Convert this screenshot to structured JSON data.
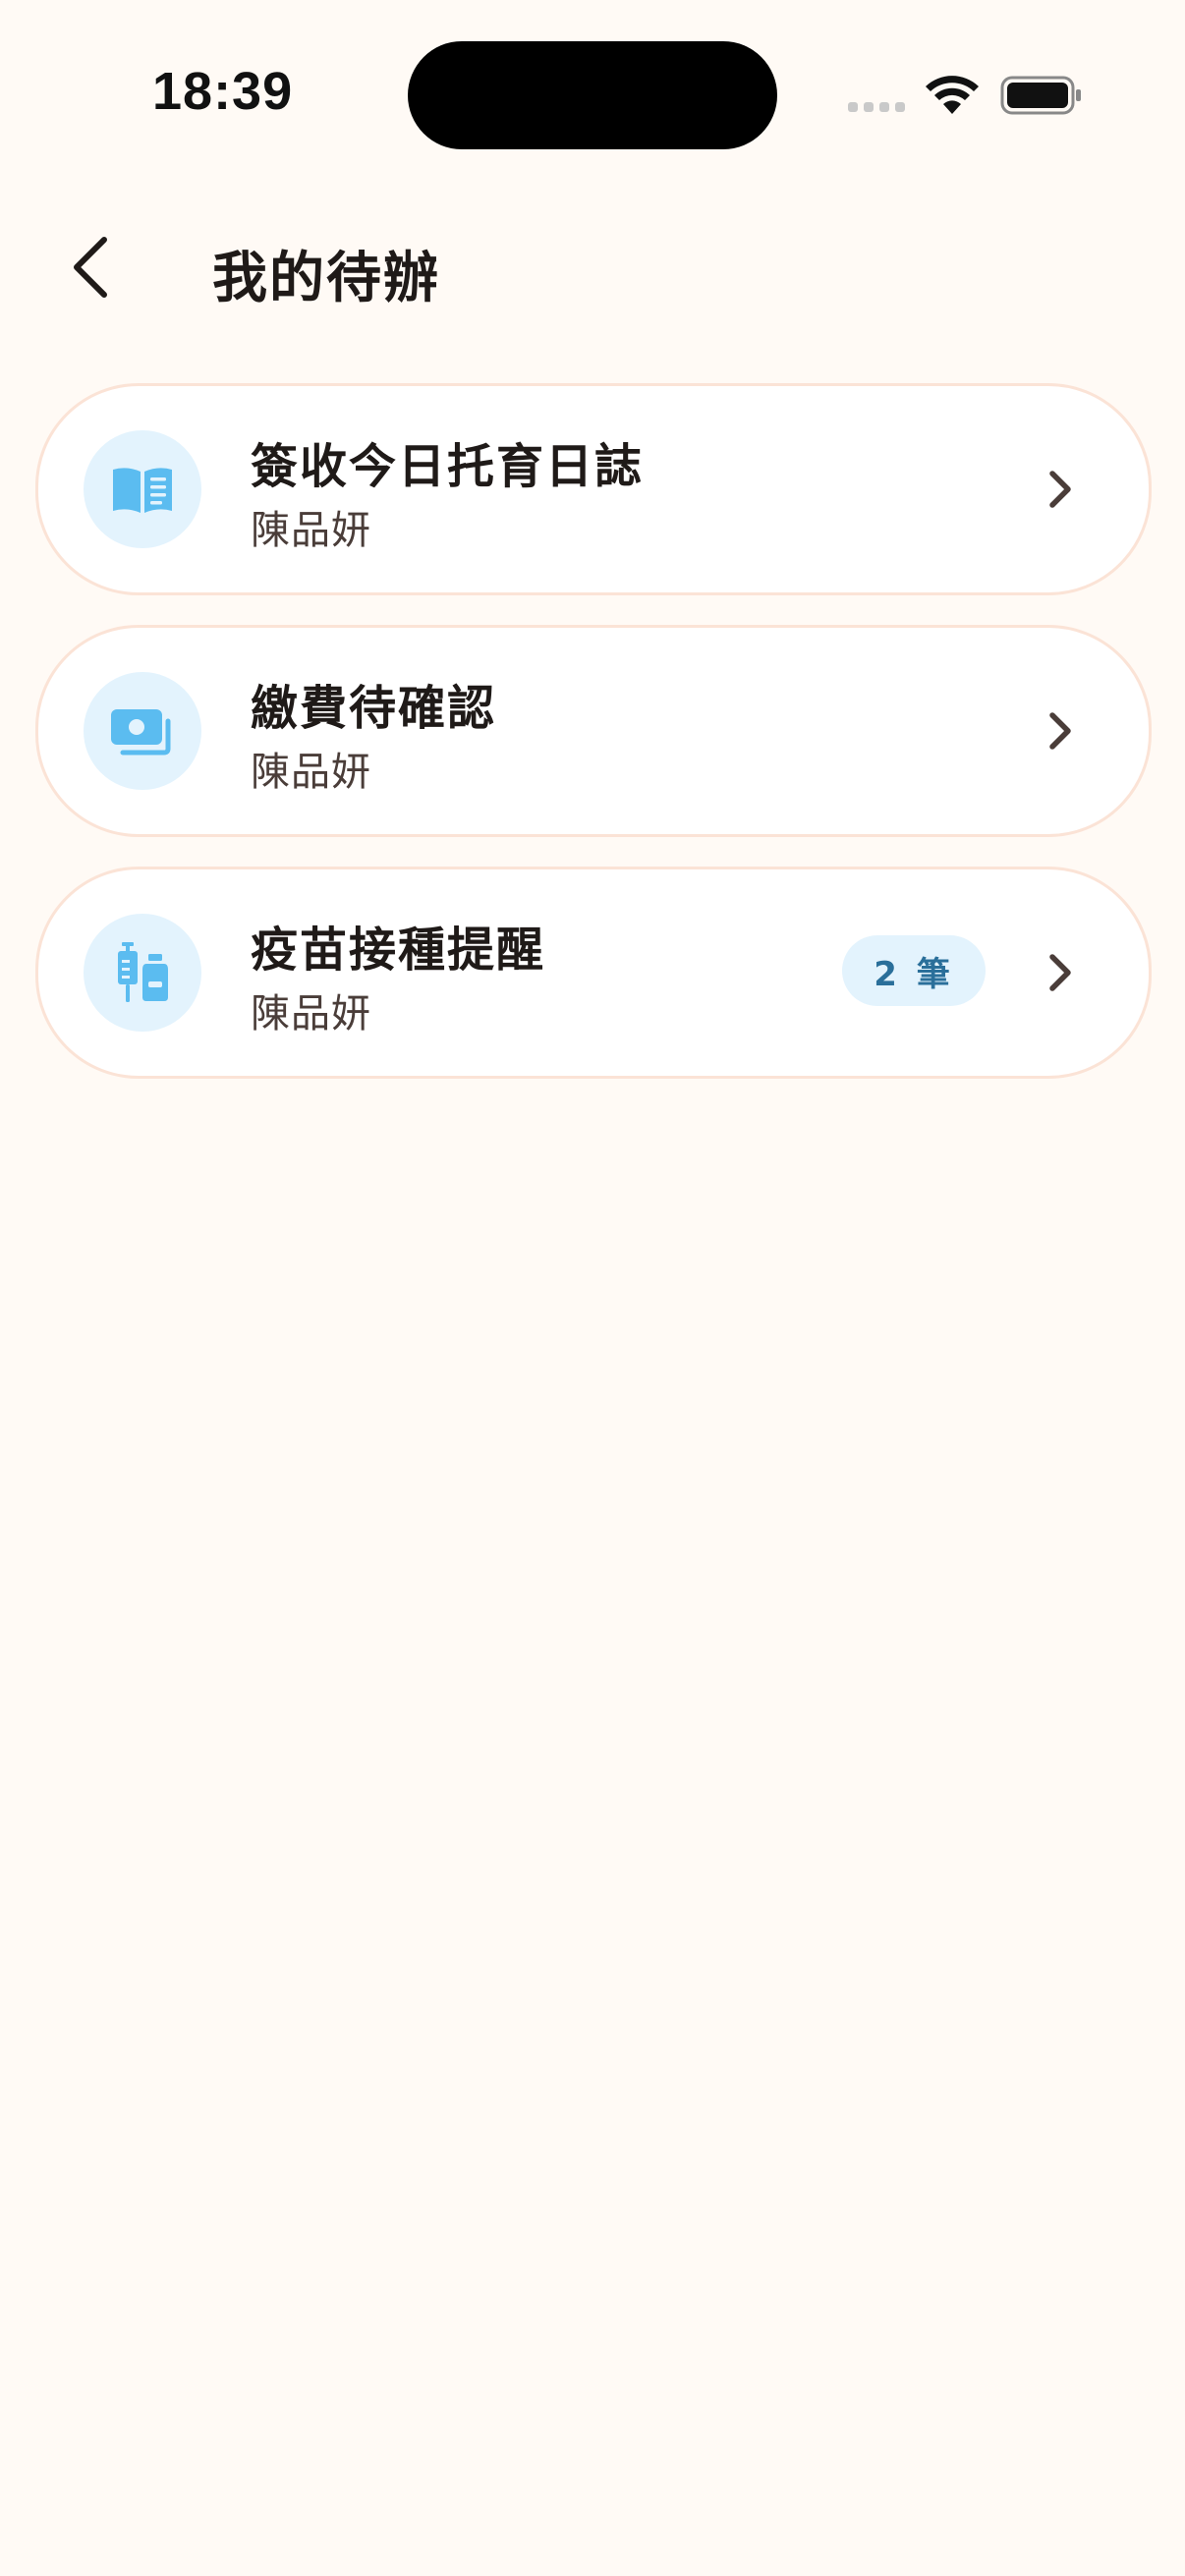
{
  "status_bar": {
    "time": "18:39"
  },
  "header": {
    "title": "我的待辦",
    "back_icon": "chevron-left-icon"
  },
  "tasks": [
    {
      "title": "簽收今日托育日誌",
      "subtitle": "陳品妍",
      "icon": "book-icon",
      "badge": null
    },
    {
      "title": "繳費待確認",
      "subtitle": "陳品妍",
      "icon": "money-icon",
      "badge": null
    },
    {
      "title": "疫苗接種提醒",
      "subtitle": "陳品妍",
      "icon": "vaccine-icon",
      "badge": "2 筆"
    }
  ],
  "colors": {
    "background": "#fffaf5",
    "card_border": "#fbe3d6",
    "icon_bg": "#e3f3fd",
    "icon_color": "#5bbcf0",
    "badge_text": "#2a6f9a"
  }
}
